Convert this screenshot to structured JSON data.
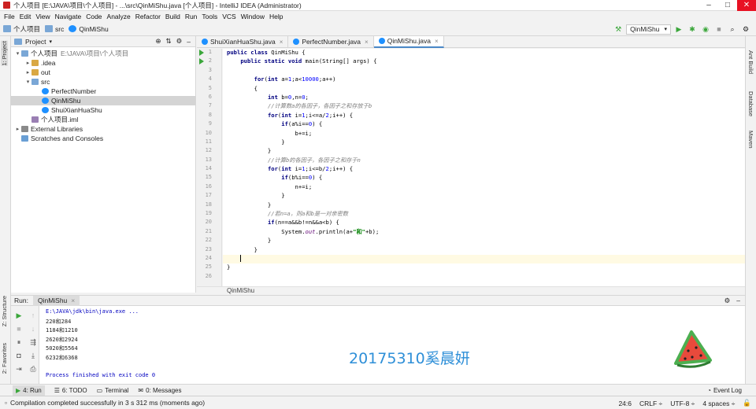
{
  "window": {
    "title": "个人项目 [E:\\JAVA\\项目\\个人项目] - ...\\src\\QinMiShu.java [个人项目] - IntelliJ IDEA (Administrator)",
    "minimize": "–",
    "maximize": "□",
    "close": "✕"
  },
  "menu": [
    "File",
    "Edit",
    "View",
    "Navigate",
    "Code",
    "Analyze",
    "Refactor",
    "Build",
    "Run",
    "Tools",
    "VCS",
    "Window",
    "Help"
  ],
  "nav": {
    "crumbs": [
      "个人项目",
      "src",
      "QinMiShu"
    ],
    "run_config": "QinMiShu"
  },
  "left_strip": {
    "project": "1: Project",
    "structure": "Z: Structure",
    "favorites": "2: Favorites"
  },
  "right_strip": {
    "ant": "Ant Build",
    "database": "Database",
    "maven": "Maven"
  },
  "project": {
    "header": "Project",
    "tree": [
      {
        "label": "个人项目",
        "path": "E:\\JAVA\\项目\\个人项目",
        "indent": 0,
        "arrow": "▾",
        "icon": "folder-blue"
      },
      {
        "label": ".idea",
        "path": "",
        "indent": 1,
        "arrow": "▸",
        "icon": "folder"
      },
      {
        "label": "out",
        "path": "",
        "indent": 1,
        "arrow": "▸",
        "icon": "folder"
      },
      {
        "label": "src",
        "path": "",
        "indent": 1,
        "arrow": "▾",
        "icon": "folder-blue"
      },
      {
        "label": "PerfectNumber",
        "path": "",
        "indent": 2,
        "arrow": "",
        "icon": "class"
      },
      {
        "label": "QinMiShu",
        "path": "",
        "indent": 2,
        "arrow": "",
        "icon": "class",
        "selected": true
      },
      {
        "label": "ShuiXianHuaShu",
        "path": "",
        "indent": 2,
        "arrow": "",
        "icon": "class"
      },
      {
        "label": "个人项目.iml",
        "path": "",
        "indent": 1,
        "arrow": "",
        "icon": "file"
      },
      {
        "label": "External Libraries",
        "path": "",
        "indent": 0,
        "arrow": "▸",
        "icon": "lib"
      },
      {
        "label": "Scratches and Consoles",
        "path": "",
        "indent": 0,
        "arrow": "",
        "icon": "scratch"
      }
    ]
  },
  "editor": {
    "tabs": [
      {
        "label": "ShuiXianHuaShu.java",
        "active": false
      },
      {
        "label": "PerfectNumber.java",
        "active": false
      },
      {
        "label": "QinMiShu.java",
        "active": true
      }
    ],
    "line_numbers": [
      "1",
      "2",
      "3",
      "4",
      "5",
      "6",
      "7",
      "8",
      "9",
      "10",
      "11",
      "12",
      "13",
      "14",
      "15",
      "16",
      "17",
      "18",
      "19",
      "20",
      "21",
      "22",
      "23",
      "24",
      "25",
      "26"
    ],
    "code_lines": [
      "<span class=\"kw\">public class</span> QinMiShu {",
      "    <span class=\"kw\">public static void</span> main(String[] args) {",
      "",
      "        <span class=\"kw\">for</span>(<span class=\"kw\">int</span> a=<span class=\"num\">1</span>;a&lt;<span class=\"num\">10000</span>;a++)",
      "        {",
      "            <span class=\"kw\">int</span> b=<span class=\"num\">0</span>,n=<span class=\"num\">0</span>;",
      "            <span class=\"cm\">//计算数a的各因子，各因子之和存放于b</span>",
      "            <span class=\"kw\">for</span>(<span class=\"kw\">int</span> i=<span class=\"num\">1</span>;i&lt;=a/<span class=\"num\">2</span>;i++) {",
      "                <span class=\"kw\">if</span>(a%i==<span class=\"num\">0</span>) {",
      "                    b+=i;",
      "                }",
      "            }",
      "            <span class=\"cm\">//计算b的各因子，各因子之和存于n</span>",
      "            <span class=\"kw\">for</span>(<span class=\"kw\">int</span> i=<span class=\"num\">1</span>;i&lt;=b/<span class=\"num\">2</span>;i++) {",
      "                <span class=\"kw\">if</span>(b%i==<span class=\"num\">0</span>) {",
      "                    n+=i;",
      "                }",
      "            }",
      "            <span class=\"cm\">//若n=a，则a和b是一对亲密数</span>",
      "            <span class=\"kw\">if</span>(n==a&amp;&amp;b!=n&amp;&amp;a&lt;b) {",
      "                System.<span class=\"fld\">out</span>.println(a+<span class=\"str\">\"和\"</span>+b);",
      "            }",
      "        }",
      "    }",
      "}",
      ""
    ],
    "current_line": 24,
    "breadcrumb": "QinMiShu"
  },
  "run": {
    "label": "Run:",
    "tab": "QinMiShu",
    "console": [
      "E:\\JAVA\\jdk\\bin\\java.exe ...",
      "220和284",
      "1184和1210",
      "2620和2924",
      "5020和5564",
      "6232和6368",
      "",
      "Process finished with exit code 0"
    ],
    "watermark": "20175310奚晨妍"
  },
  "bottom_tools": [
    "4: Run",
    "6: TODO",
    "Terminal",
    "0: Messages"
  ],
  "event_log": "Event Log",
  "status": {
    "message": "Compilation completed successfully in 3 s 312 ms (moments ago)",
    "position": "24:6",
    "line_sep": "CRLF ÷",
    "encoding": "UTF-8 ÷",
    "indent": "4 spaces ÷"
  },
  "colors": {
    "accent": "#4a88c7",
    "run_green": "#3aa63a",
    "watermark": "#2e8fd8"
  }
}
